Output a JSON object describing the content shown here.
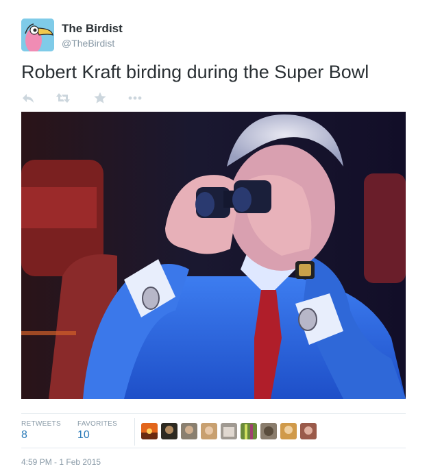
{
  "tweet": {
    "author_name": "The Birdist",
    "author_handle": "@TheBirdist",
    "text": "Robert Kraft birding during the Super Bowl",
    "timestamp": "4:59 PM - 1 Feb 2015"
  },
  "actions": [
    {
      "icon": "reply-icon"
    },
    {
      "icon": "retweet-icon"
    },
    {
      "icon": "favorite-star-icon"
    },
    {
      "icon": "more-icon"
    }
  ],
  "stats": {
    "retweets_label": "RETWEETS",
    "retweets_count": "8",
    "favorites_label": "FAVORITES",
    "favorites_count": "10"
  },
  "favoriter_avatars": [
    {
      "color": "#e2651b"
    },
    {
      "color": "#2d2a22"
    },
    {
      "color": "#8a8070"
    },
    {
      "color": "#c8a070"
    },
    {
      "color": "#a09a92"
    },
    {
      "color": "#6a8a3a"
    },
    {
      "color": "#8a7d6d"
    },
    {
      "color": "#d09a4a"
    },
    {
      "color": "#9a5a4a"
    }
  ],
  "colors": {
    "link": "#2b7bb9",
    "muted": "#8899a6",
    "text": "#292f33",
    "action_icon": "#ccd6dd"
  }
}
